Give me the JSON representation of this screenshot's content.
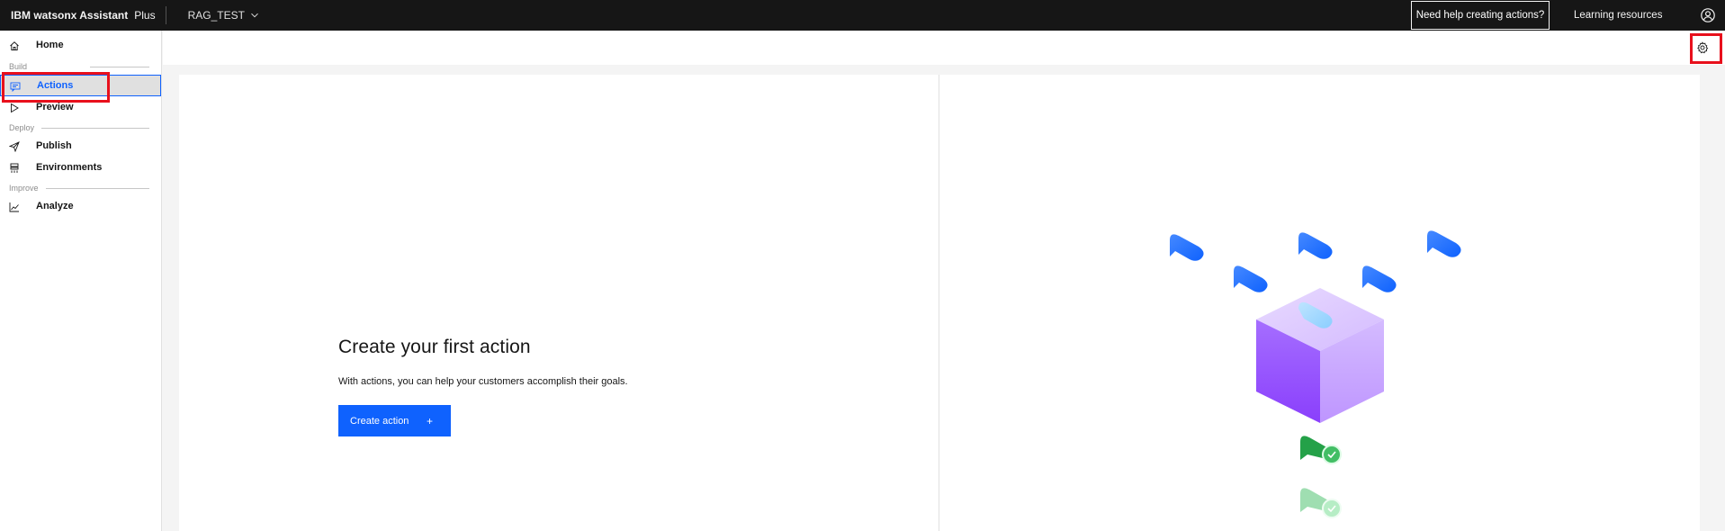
{
  "header": {
    "brand_name": "IBM watsonx Assistant",
    "brand_plan": "Plus",
    "assistant_switcher": "RAG_TEST",
    "help_button": "Need help creating actions?",
    "learning_link": "Learning resources",
    "icons": [
      "chevron-down-icon",
      "user-avatar-icon"
    ]
  },
  "sidebar": {
    "items": [
      {
        "label": "Home",
        "icon": "home-icon"
      },
      {
        "section": "Build"
      },
      {
        "label": "Actions",
        "icon": "actions-icon",
        "active": true
      },
      {
        "label": "Preview",
        "icon": "play-icon"
      },
      {
        "section": "Deploy"
      },
      {
        "label": "Publish",
        "icon": "send-icon"
      },
      {
        "label": "Environments",
        "icon": "environments-icon"
      },
      {
        "section": "Improve"
      },
      {
        "label": "Analyze",
        "icon": "analyze-chart-icon"
      }
    ],
    "sections": {
      "build": "Build",
      "deploy": "Deploy",
      "improve": "Improve"
    },
    "home": "Home",
    "actions": "Actions",
    "preview": "Preview",
    "publish": "Publish",
    "environments": "Environments",
    "analyze": "Analyze"
  },
  "toolbar": {
    "settings_icon": "settings-gear-icon"
  },
  "main": {
    "title": "Create your first action",
    "description": "With actions, you can help your customers accomplish their goals.",
    "create_button": "Create action",
    "create_button_icon": "+"
  },
  "colors": {
    "header_bg": "#161616",
    "accent": "#0f62fe",
    "highlight": "#e8101c",
    "cube": "#a56eff"
  }
}
